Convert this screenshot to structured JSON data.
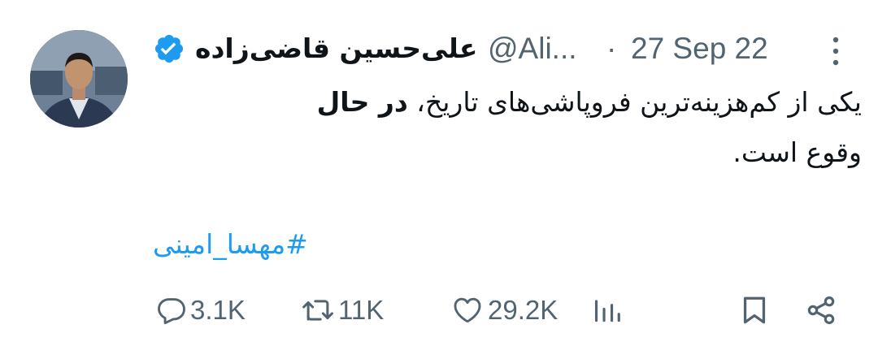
{
  "tweet": {
    "author": {
      "display_name": "علی‌حسین قاضی‌زاده",
      "handle": "@Ali...",
      "avatar": "avatar-photo"
    },
    "separator": "·",
    "timestamp": "27 Sep 22",
    "text": {
      "line1_normal": "یکی از کم‌هزینه‌ترین فروپاشی‌های تاریخ، ",
      "line1_bold": "در حال",
      "line2": "وقوع است."
    },
    "hashtag": "#مهسا_امینی"
  },
  "actions": {
    "reply": {
      "icon": "reply-icon",
      "count": "3.1K"
    },
    "retweet": {
      "icon": "retweet-icon",
      "count": "11K"
    },
    "like": {
      "icon": "heart-icon",
      "count": "29.2K"
    },
    "views": {
      "icon": "views-icon"
    },
    "bookmark": {
      "icon": "bookmark-icon"
    },
    "share": {
      "icon": "share-icon"
    }
  },
  "colors": {
    "text": "#0f1419",
    "secondary": "#536471",
    "accent": "#1d9bf0"
  }
}
